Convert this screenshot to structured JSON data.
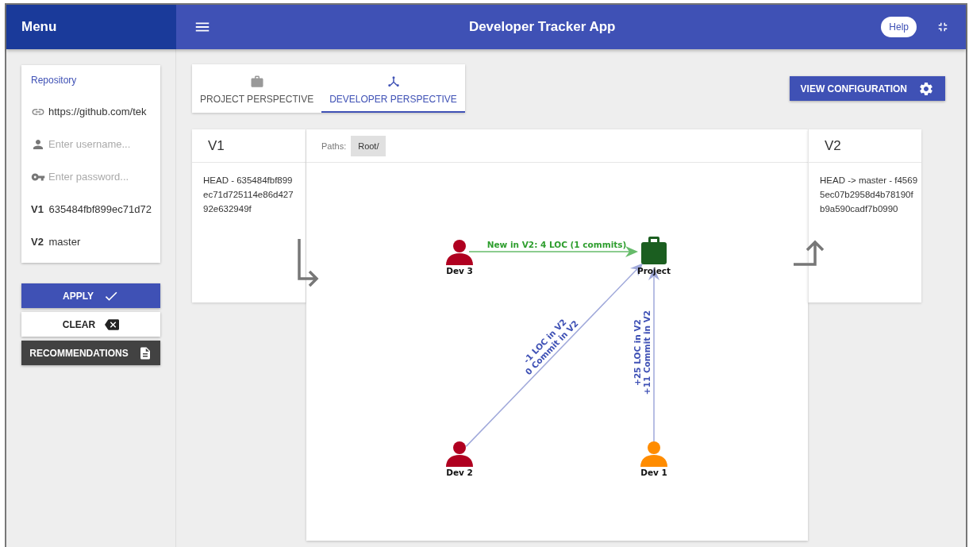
{
  "header": {
    "menu_title": "Menu",
    "title": "Developer Tracker App",
    "help": "Help"
  },
  "repository": {
    "heading": "Repository",
    "url": "https://github.com/tek",
    "username_placeholder": "Enter username...",
    "password_placeholder": "Enter password...",
    "v1_label": "V1",
    "v1_value": "635484fbf899ec71d72",
    "v2_label": "V2",
    "v2_value": "master"
  },
  "buttons": [
    {
      "label": "APPLY",
      "kind": "apply"
    },
    {
      "label": "CLEAR",
      "kind": "clear"
    },
    {
      "label": "RECOMMENDATIONS",
      "kind": "recommendations"
    }
  ],
  "tabs": [
    {
      "label": "PROJECT PERSPECTIVE",
      "kind": "project",
      "selected": false
    },
    {
      "label": "DEVELOPER PERSPECTIVE",
      "kind": "developer",
      "selected": true
    }
  ],
  "view_configuration": "VIEW CONFIGURATION",
  "compare": {
    "v1_title": "V1",
    "v1_commit": "HEAD - 635484fbf899ec71d725114e86d42792e632949f",
    "paths_label": "Paths:",
    "path": "Root/",
    "v2_title": "V2",
    "v2_commit": "HEAD -> master - f45695ec07b2958d4b78190fb9a590cadf7b0990"
  },
  "graph": {
    "nodes": [
      {
        "label": "Dev 3",
        "kind": "developer",
        "color": "#b00020"
      },
      {
        "label": "Project",
        "kind": "project",
        "color": "#1b5e20"
      },
      {
        "label": "Dev 2",
        "kind": "developer",
        "color": "#b00020"
      },
      {
        "label": "Dev 1",
        "kind": "developer",
        "color": "#ff8c00"
      }
    ],
    "edges": [
      {
        "kind": "new",
        "lines": [
          "New in V2: 4 LOC (1 commits)"
        ]
      },
      {
        "kind": "changed",
        "lines": [
          "-1 LOC in V2",
          "0 Commit in V2"
        ]
      },
      {
        "kind": "changed",
        "lines": [
          "+25 LOC in V2",
          "+11 Commit in V2"
        ]
      }
    ]
  }
}
